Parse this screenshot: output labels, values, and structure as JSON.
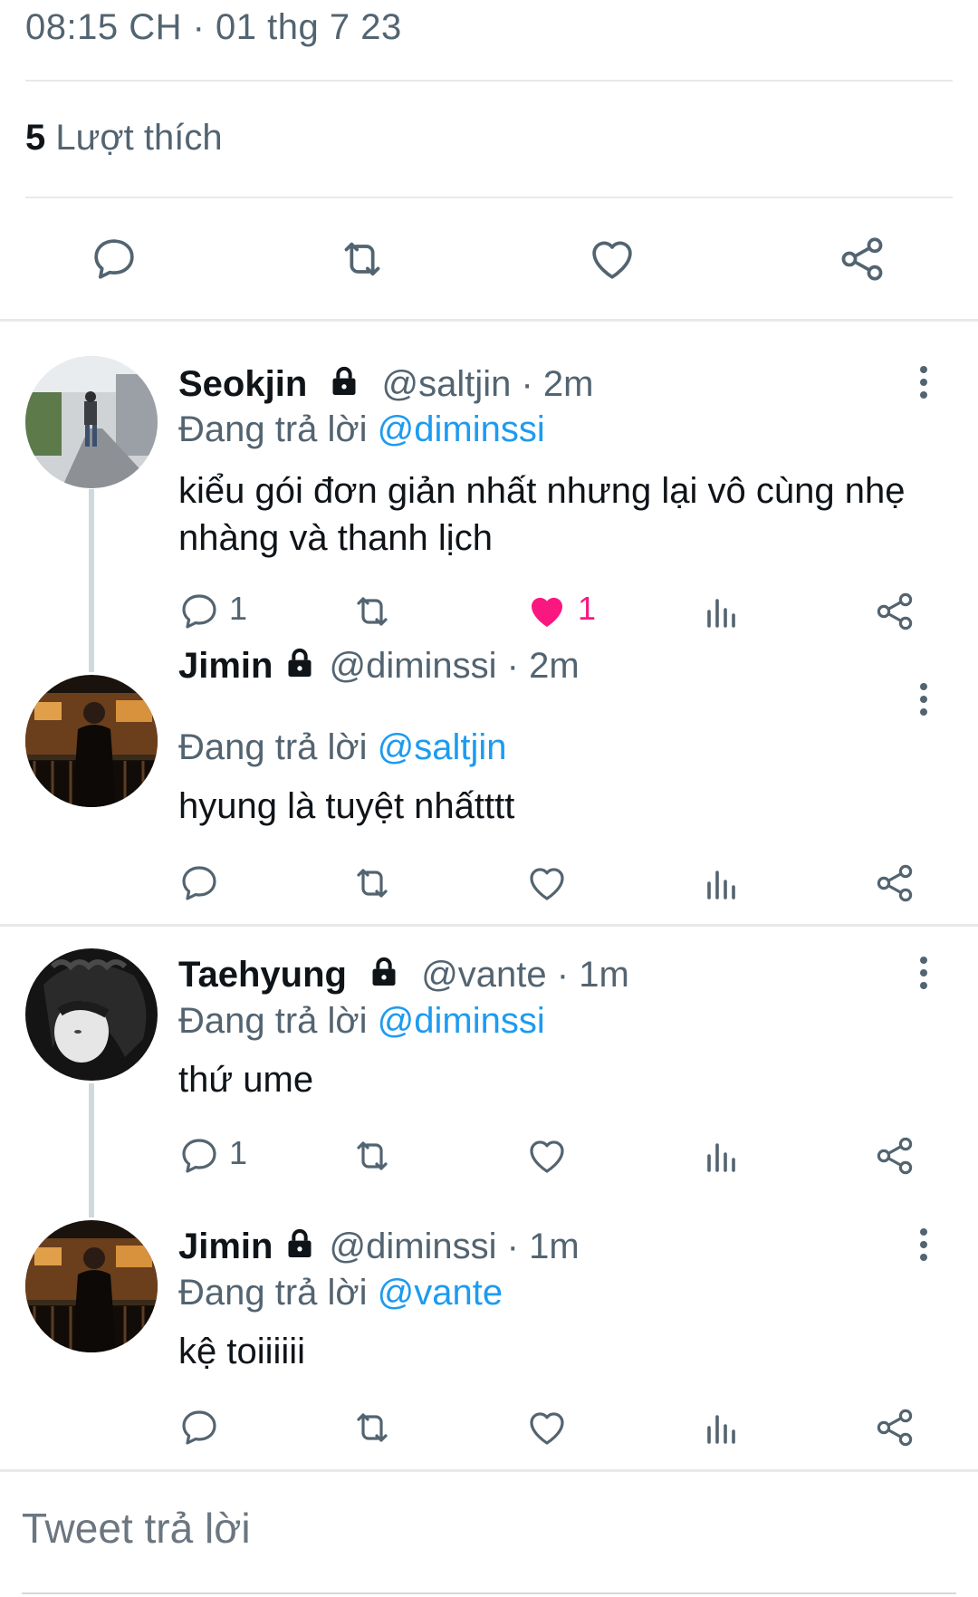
{
  "tweet": {
    "timestamp": "08:15 CH · 01 thg 7 23",
    "likes_count": "5",
    "likes_label": "Lượt thích"
  },
  "replies": [
    {
      "name": "Seokjin",
      "handle_time": "@saltjin · 2m",
      "reply_prefix": "Đang trả lời",
      "reply_to": "@diminssi",
      "text": "kiểu gói đơn giản nhất nhưng lại vô cùng nhẹ nhàng và thanh lịch",
      "reply_count": "1",
      "retweet_count": "",
      "like_count": "1",
      "liked": true
    },
    {
      "name": "Jimin",
      "handle_time": "@diminssi · 2m",
      "reply_prefix": "Đang trả lời",
      "reply_to": "@saltjin",
      "text": "hyung là tuyệt nhấtttt",
      "reply_count": "",
      "retweet_count": "",
      "like_count": "",
      "liked": false
    },
    {
      "name": "Taehyung",
      "handle_time": "@vante · 1m",
      "reply_prefix": "Đang trả lời",
      "reply_to": "@diminssi",
      "text": "thứ ume",
      "reply_count": "1",
      "retweet_count": "",
      "like_count": "",
      "liked": false
    },
    {
      "name": "Jimin",
      "handle_time": "@diminssi · 1m",
      "reply_prefix": "Đang trả lời",
      "reply_to": "@vante",
      "text": "kệ toiiiiii",
      "reply_count": "",
      "retweet_count": "",
      "like_count": "",
      "liked": false
    }
  ],
  "compose": {
    "placeholder": "Tweet trả lời"
  },
  "icons": {
    "main_actions": [
      "reply-icon",
      "retweet-icon",
      "like-icon",
      "share-icon"
    ],
    "tweet_actions": [
      "reply-icon",
      "retweet-icon",
      "like-icon",
      "views-icon",
      "share-icon"
    ],
    "lock": "lock-icon",
    "more": "more-vertical-icon"
  },
  "colors": {
    "accent": "#1d9bf0",
    "like": "#f91880",
    "muted": "#536471",
    "text": "#0f1419"
  }
}
